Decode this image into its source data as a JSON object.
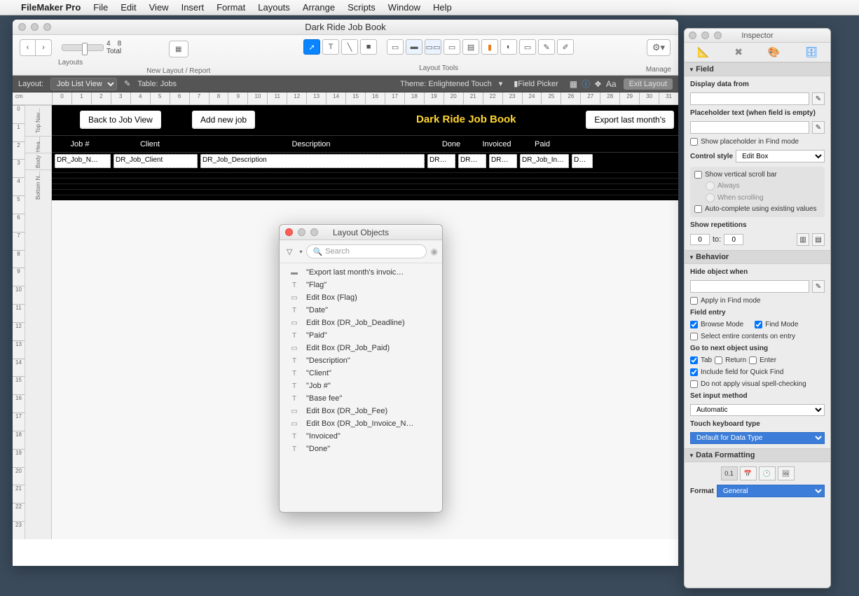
{
  "menubar": {
    "app": "FileMaker Pro",
    "items": [
      "File",
      "Edit",
      "View",
      "Insert",
      "Format",
      "Layouts",
      "Arrange",
      "Scripts",
      "Window",
      "Help"
    ]
  },
  "main": {
    "title": "Dark Ride Job Book",
    "toolbar": {
      "layouts_label": "Layouts",
      "new_layout_label": "New Layout / Report",
      "tools_label": "Layout Tools",
      "manage_label": "Manage",
      "total_count": "8",
      "total_label": "Total",
      "current": "4"
    },
    "layoutbar": {
      "layout_label": "Layout:",
      "layout_value": "Job List View",
      "table_label": "Table: Jobs",
      "theme_label": "Theme: Enlightened Touch",
      "field_picker": "Field Picker",
      "exit": "Exit Layout",
      "Aa": "Aa"
    },
    "ruler_unit": "cm",
    "ruler_numbers": [
      "0",
      "1",
      "2",
      "3",
      "4",
      "5",
      "6",
      "7",
      "8",
      "9",
      "10",
      "11",
      "12",
      "13",
      "14",
      "15",
      "16",
      "17",
      "18",
      "19",
      "20",
      "21",
      "22",
      "23",
      "24",
      "25",
      "26",
      "27",
      "28",
      "29",
      "30",
      "31"
    ],
    "part_labels": [
      "Top Nav...",
      "Hea...",
      "Body",
      "Bottom N..."
    ],
    "buttons": {
      "back": "Back to Job View",
      "add": "Add new job",
      "export": "Export last month's"
    },
    "title_text": "Dark Ride Job Book",
    "headers": [
      "Job #",
      "Client",
      "Description",
      "Done",
      "Invoiced",
      "Paid"
    ],
    "fields": [
      "DR_Job_N…",
      "DR_Job_Client",
      "DR_Job_Description",
      "DR…",
      "DR…",
      "DR…",
      "DR_Job_In…",
      "D…"
    ]
  },
  "objects": {
    "title": "Layout Objects",
    "search_placeholder": "Search",
    "items": [
      {
        "icon": "btn",
        "label": "\"Export last month's invoic…"
      },
      {
        "icon": "T",
        "label": "\"Flag\""
      },
      {
        "icon": "box",
        "label": "Edit Box (Flag)"
      },
      {
        "icon": "T",
        "label": "\"Date\""
      },
      {
        "icon": "box",
        "label": "Edit Box (DR_Job_Deadline)"
      },
      {
        "icon": "T",
        "label": "\"Paid\""
      },
      {
        "icon": "box",
        "label": "Edit Box (DR_Job_Paid)"
      },
      {
        "icon": "T",
        "label": "\"Description\""
      },
      {
        "icon": "T",
        "label": "\"Client\""
      },
      {
        "icon": "T",
        "label": "\"Job #\""
      },
      {
        "icon": "T",
        "label": "\"Base fee\""
      },
      {
        "icon": "box",
        "label": "Edit Box (DR_Job_Fee)"
      },
      {
        "icon": "box",
        "label": "Edit Box (DR_Job_Invoice_N…"
      },
      {
        "icon": "T",
        "label": "\"Invoiced\""
      },
      {
        "icon": "T",
        "label": "\"Done\""
      }
    ]
  },
  "inspector": {
    "title": "Inspector",
    "sections": {
      "field": "Field",
      "behavior": "Behavior",
      "data_formatting": "Data Formatting"
    },
    "display_label": "Display data from",
    "placeholder_label": "Placeholder text (when field is empty)",
    "show_placeholder": "Show placeholder in Find mode",
    "control_style_label": "Control style",
    "control_style_value": "Edit Box",
    "scroll": "Show vertical scroll bar",
    "always": "Always",
    "when_scrolling": "When scrolling",
    "autocomplete": "Auto-complete using existing values",
    "repetitions_label": "Show repetitions",
    "rep_from": "0",
    "rep_to_label": "to:",
    "rep_to": "0",
    "hide_label": "Hide object when",
    "apply_find": "Apply in Find mode",
    "entry_label": "Field entry",
    "browse": "Browse Mode",
    "find": "Find Mode",
    "select_entire": "Select entire contents on entry",
    "goto_label": "Go to next object using",
    "tab": "Tab",
    "return": "Return",
    "enter": "Enter",
    "quick_find": "Include field for Quick Find",
    "spell": "Do not apply visual spell-checking",
    "input_method_label": "Set input method",
    "input_method_value": "Automatic",
    "touch_label": "Touch keyboard type",
    "touch_value": "Default for Data Type",
    "format_label": "Format",
    "format_value": "General",
    "format_icon_active": "0.1"
  }
}
